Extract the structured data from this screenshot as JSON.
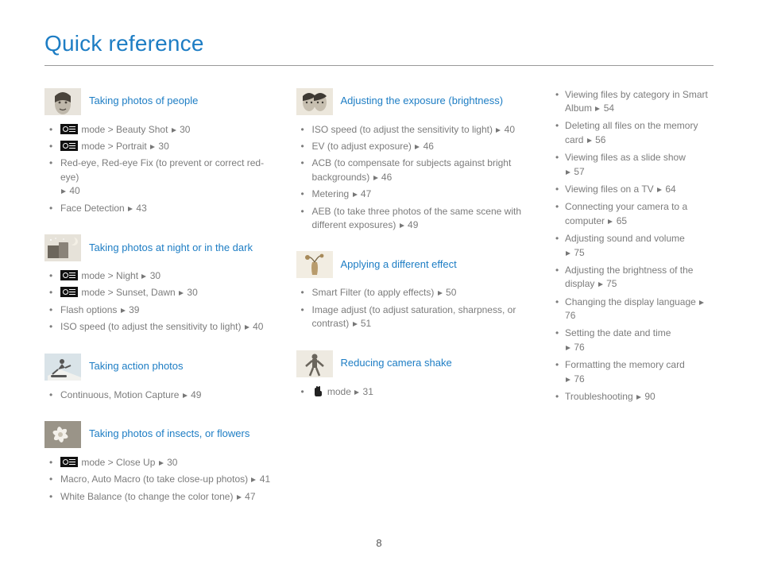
{
  "title": "Quick reference",
  "page_number": "8",
  "left": [
    {
      "heading": "Taking photos of people",
      "thumb": "face",
      "items": [
        {
          "mode": true,
          "text": " mode > Beauty Shot ",
          "page": "30"
        },
        {
          "mode": true,
          "text": " mode > Portrait ",
          "page": "30"
        },
        {
          "text": "Red-eye, Red-eye Fix (to prevent or correct red-eye) ",
          "page": "40",
          "wrap": true
        },
        {
          "text": "Face Detection ",
          "page": "43"
        }
      ]
    },
    {
      "heading": "Taking photos at night or in the dark",
      "thumb": "night",
      "items": [
        {
          "mode": true,
          "text": " mode > Night ",
          "page": "30"
        },
        {
          "mode": true,
          "text": " mode > Sunset, Dawn ",
          "page": "30"
        },
        {
          "text": "Flash options ",
          "page": "39"
        },
        {
          "text": "ISO speed (to adjust the sensitivity to light) ",
          "page": "40"
        }
      ]
    },
    {
      "heading": "Taking action photos",
      "thumb": "action",
      "items": [
        {
          "text": "Continuous, Motion Capture ",
          "page": "49"
        }
      ]
    },
    {
      "heading": "Taking photos of insects, or flowers",
      "thumb": "flower",
      "items": [
        {
          "mode": true,
          "text": " mode > Close Up ",
          "page": "30"
        },
        {
          "text": "Macro, Auto Macro (to take close-up photos) ",
          "page": "41"
        },
        {
          "text": "White Balance (to change the color tone) ",
          "page": "47"
        }
      ]
    }
  ],
  "mid": [
    {
      "heading": "Adjusting the exposure (brightness)",
      "thumb": "couple",
      "items": [
        {
          "text": "ISO speed (to adjust the sensitivity to light) ",
          "page": "40"
        },
        {
          "text": "EV (to adjust exposure) ",
          "page": "46"
        },
        {
          "text": "ACB (to compensate for subjects against bright backgrounds) ",
          "page": "46"
        },
        {
          "text": "Metering ",
          "page": "47"
        },
        {
          "text": "AEB (to take three photos of the same scene with different exposures) ",
          "page": "49"
        }
      ]
    },
    {
      "heading": "Applying a different effect",
      "thumb": "vase",
      "items": [
        {
          "text": "Smart Filter (to apply effects) ",
          "page": "50"
        },
        {
          "text": "Image adjust (to adjust saturation, sharpness, or contrast) ",
          "page": "51"
        }
      ]
    },
    {
      "heading": "Reducing camera shake",
      "thumb": "shake",
      "items": [
        {
          "hand": true,
          "text": " mode ",
          "page": "31"
        }
      ]
    }
  ],
  "right": [
    {
      "text": "Viewing files by category in Smart Album ",
      "page": "54"
    },
    {
      "text": "Deleting all files on the memory card ",
      "page": "56"
    },
    {
      "text": "Viewing files as a slide show ",
      "page": "57",
      "wrap": true
    },
    {
      "text": "Viewing files on a TV ",
      "page": "64"
    },
    {
      "text": "Connecting your camera to a computer ",
      "page": "65"
    },
    {
      "text": "Adjusting sound and volume ",
      "page": "75",
      "wrap": true
    },
    {
      "text": "Adjusting the brightness of the display ",
      "page": "75"
    },
    {
      "text": "Changing the display language ",
      "page": "76"
    },
    {
      "text": "Setting the date and time ",
      "page": "76",
      "wrap": true
    },
    {
      "text": "Formatting the memory card ",
      "page": "76",
      "wrap": true
    },
    {
      "text": "Troubleshooting ",
      "page": "90"
    }
  ]
}
